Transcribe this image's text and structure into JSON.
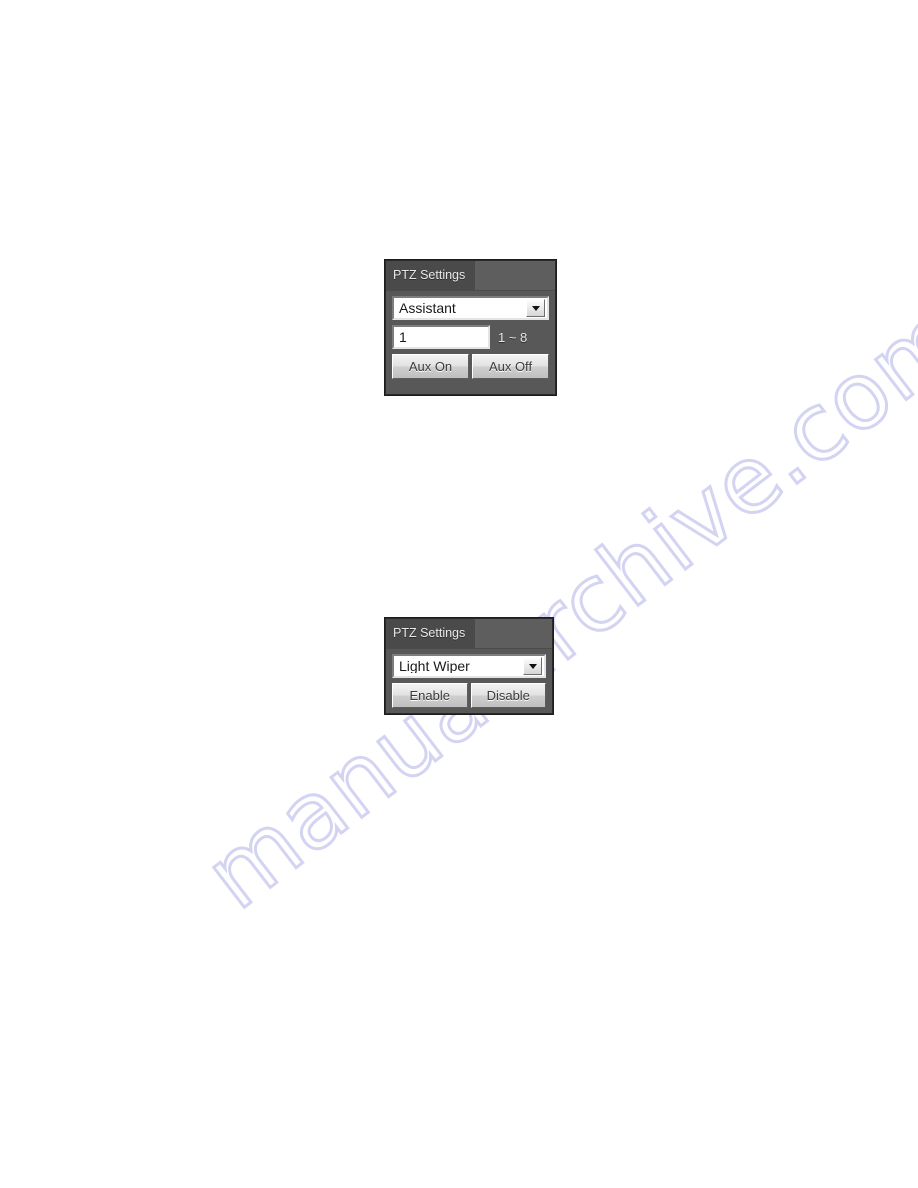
{
  "page": {
    "background_color": "#ffffff",
    "watermark_text": "manualarchive.com",
    "watermark_color": "#d3d3f2"
  },
  "panels": [
    {
      "id": "ptz-aux",
      "title": "PTZ Settings",
      "dropdown": {
        "selected": "Assistant",
        "arrow_icon": "chevron-down-icon"
      },
      "input": {
        "value": "1",
        "placeholder": "",
        "range_hint": "1 ~ 8"
      },
      "buttons": [
        {
          "label": "Aux On"
        },
        {
          "label": "Aux Off"
        }
      ]
    },
    {
      "id": "ptz-light-wiper",
      "title": "PTZ Settings",
      "dropdown": {
        "selected": "Light Wiper",
        "arrow_icon": "chevron-down-icon"
      },
      "buttons": [
        {
          "label": "Enable"
        },
        {
          "label": "Disable"
        }
      ]
    }
  ]
}
